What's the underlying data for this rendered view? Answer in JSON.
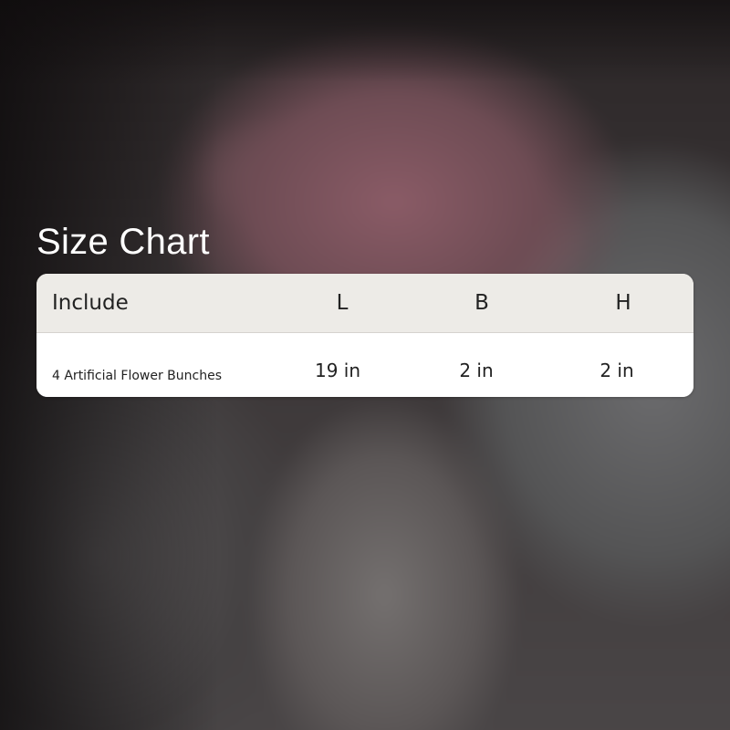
{
  "title": "Size Chart",
  "table": {
    "headers": [
      "Include",
      "L",
      "B",
      "H"
    ],
    "rows": [
      [
        "4 Artificial Flower Bunches",
        "19 in",
        "2 in",
        "2 in"
      ]
    ]
  },
  "colors": {
    "header_bg": "#edebe7",
    "row_bg": "#ffffff",
    "text": "#222222",
    "title": "#ffffff"
  }
}
